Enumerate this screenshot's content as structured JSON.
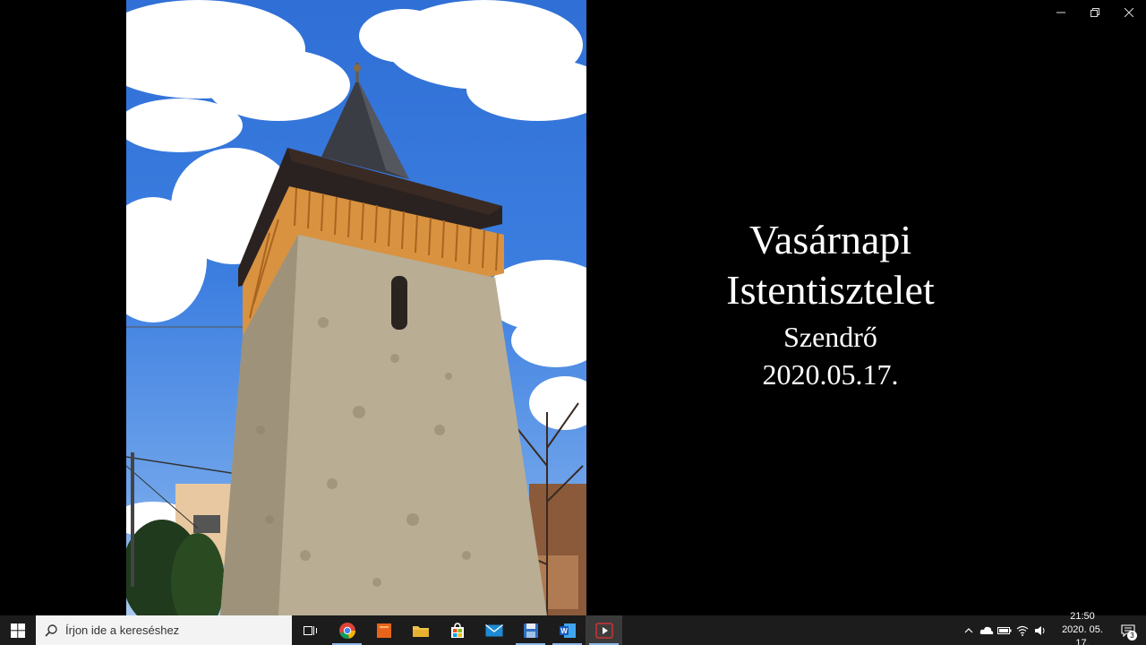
{
  "window": {
    "minimize_icon": "minimize-icon",
    "restore_icon": "restore-icon",
    "close_icon": "close-icon"
  },
  "slide": {
    "line1": "Vasárnapi",
    "line2": "Istentisztelet",
    "line3": "Szendrő",
    "line4": "2020.05.17."
  },
  "taskbar": {
    "search_placeholder": "Írjon ide a kereséshez",
    "apps": [
      {
        "name": "task-view-icon"
      },
      {
        "name": "chrome-icon"
      },
      {
        "name": "orange-app-icon"
      },
      {
        "name": "file-explorer-icon"
      },
      {
        "name": "store-icon"
      },
      {
        "name": "mail-icon"
      },
      {
        "name": "save-disk-icon"
      },
      {
        "name": "word-icon"
      },
      {
        "name": "video-player-icon"
      }
    ],
    "clock_time": "21:50",
    "clock_date": "2020. 05. 17.",
    "notification_count": "3"
  },
  "colors": {
    "taskbar_bg": "#1c1c1c",
    "accent": "#8fb9e8",
    "background": "#000000"
  }
}
